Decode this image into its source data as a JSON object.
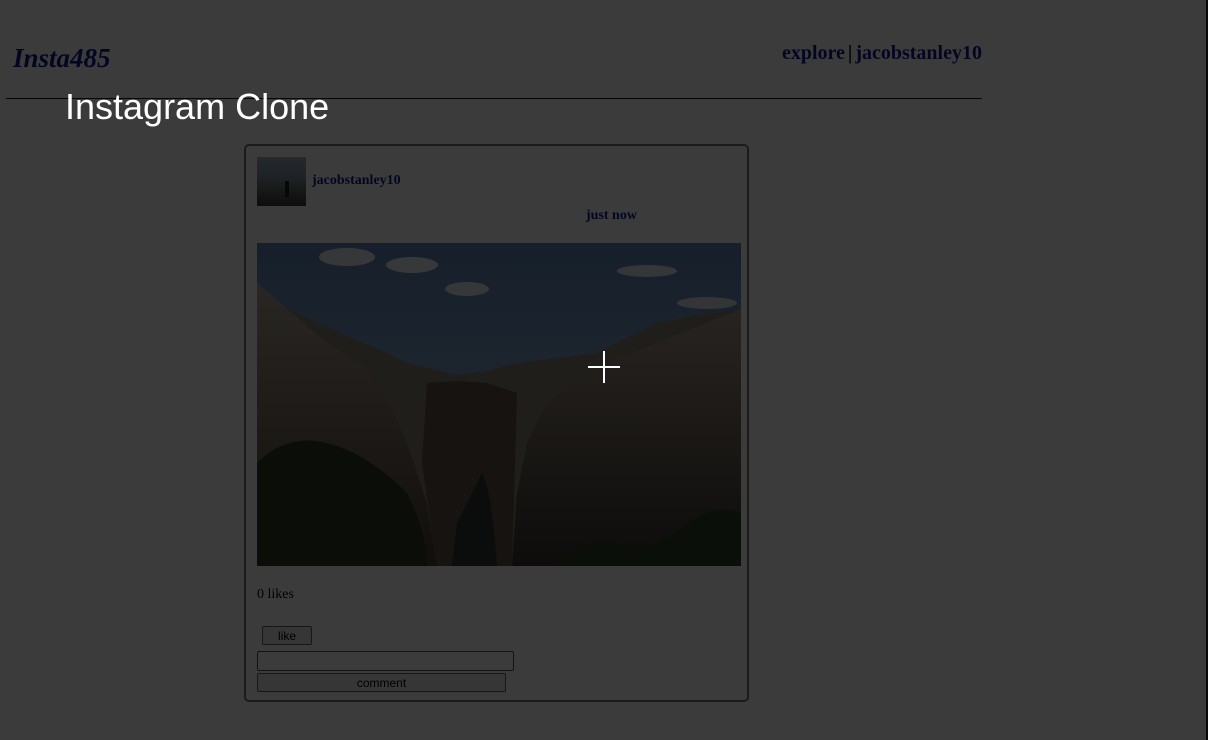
{
  "header": {
    "brand": "Insta485",
    "nav_explore": "explore",
    "nav_separator": "|",
    "nav_user": "jacobstanley10"
  },
  "overlay": {
    "title": "Instagram Clone",
    "cursor_icon": "crosshair-icon"
  },
  "post": {
    "owner": "jacobstanley10",
    "timestamp": "just now",
    "likes_text": "0 likes",
    "like_button": "like",
    "comment_placeholder": "",
    "comment_button": "comment"
  },
  "colors": {
    "link": "#0a1a8c",
    "overlay": "rgba(0,0,0,0.77)",
    "title_text": "#ffffff"
  }
}
